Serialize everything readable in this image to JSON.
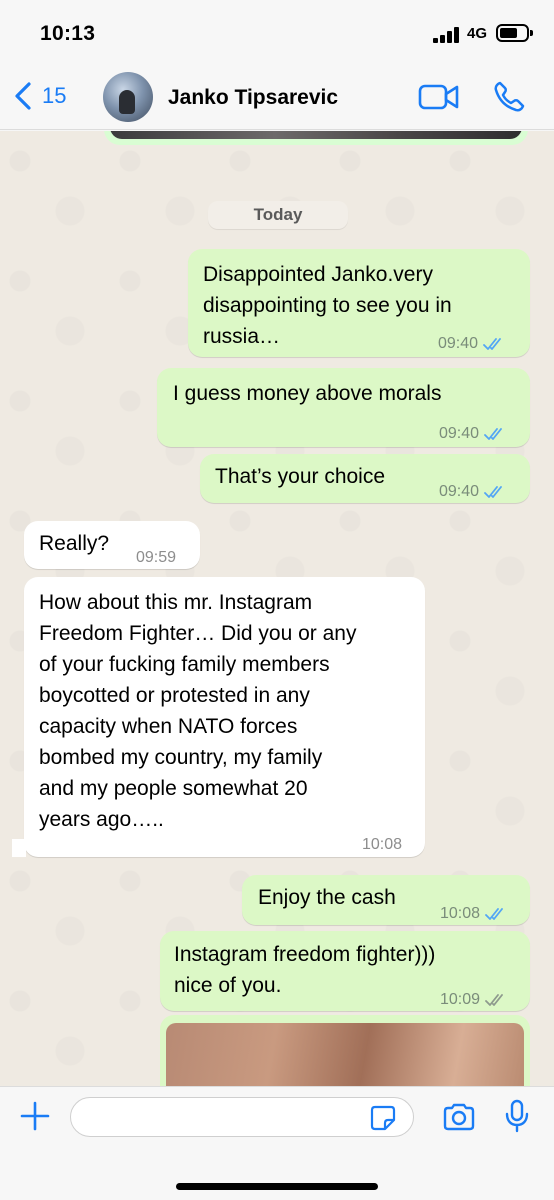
{
  "status_bar": {
    "time": "10:13",
    "network": "4G"
  },
  "header": {
    "back_count": "15",
    "contact_name": "Janko Tipsarevic"
  },
  "chat": {
    "date_label": "Today",
    "messages": [
      {
        "direction": "out",
        "lines": [
          "Disappointed Janko.very",
          "disappointing to see you in",
          "russia…"
        ],
        "time": "09:40",
        "status": "read"
      },
      {
        "direction": "out",
        "lines": [
          "I guess money above morals"
        ],
        "time": "09:40",
        "status": "read"
      },
      {
        "direction": "out",
        "lines": [
          "That’s your choice"
        ],
        "time": "09:40",
        "status": "read"
      },
      {
        "direction": "in",
        "lines": [
          "Really?"
        ],
        "time": "09:59"
      },
      {
        "direction": "in",
        "lines": [
          "How about this mr. Instagram",
          "Freedom Fighter… Did you or any",
          "of your fucking family members",
          "boycotted or protested in any",
          "capacity when NATO forces",
          "bombed my country, my family",
          "and my people somewhat 20",
          "years ago….."
        ],
        "time": "10:08"
      },
      {
        "direction": "out",
        "lines": [
          "Enjoy the cash"
        ],
        "time": "10:08",
        "status": "read"
      },
      {
        "direction": "out",
        "lines": [
          "Instagram freedom fighter)))",
          "nice of you."
        ],
        "time": "10:09",
        "status": "delivered"
      }
    ]
  },
  "composer": {
    "placeholder": ""
  },
  "colors": {
    "accent": "#1a7cf5",
    "outgoing_bubble": "#dcf8c6",
    "incoming_bubble": "#ffffff",
    "read_ticks": "#53a6f5",
    "delivered_ticks": "#8e9a8e"
  }
}
